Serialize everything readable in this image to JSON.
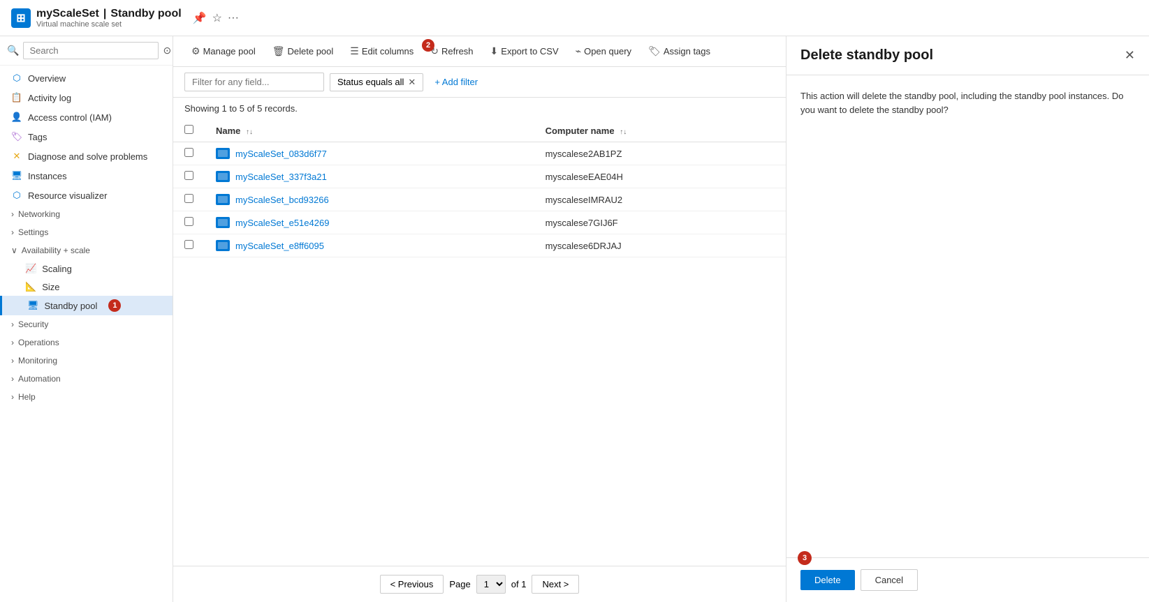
{
  "header": {
    "app_title": "myScaleSet",
    "separator": "|",
    "page_title": "Standby pool",
    "subtitle": "Virtual machine scale set",
    "pin_icon": "📌",
    "star_icon": "☆",
    "more_icon": "···"
  },
  "sidebar": {
    "search_placeholder": "Search",
    "nav_items": [
      {
        "id": "overview",
        "label": "Overview",
        "icon": "🏠",
        "indent": false,
        "active": false
      },
      {
        "id": "activity-log",
        "label": "Activity log",
        "icon": "📋",
        "indent": false,
        "active": false
      },
      {
        "id": "iam",
        "label": "Access control (IAM)",
        "icon": "👤",
        "indent": false,
        "active": false
      },
      {
        "id": "tags",
        "label": "Tags",
        "icon": "🏷",
        "indent": false,
        "active": false
      },
      {
        "id": "diagnose",
        "label": "Diagnose and solve problems",
        "icon": "🔧",
        "indent": false,
        "active": false
      },
      {
        "id": "instances",
        "label": "Instances",
        "icon": "💻",
        "indent": false,
        "active": false
      },
      {
        "id": "resource-viz",
        "label": "Resource visualizer",
        "icon": "🔗",
        "indent": false,
        "active": false
      },
      {
        "id": "networking",
        "label": "Networking",
        "icon": ">",
        "indent": false,
        "active": false,
        "group": true
      },
      {
        "id": "settings",
        "label": "Settings",
        "icon": ">",
        "indent": false,
        "active": false,
        "group": true
      },
      {
        "id": "avail-scale",
        "label": "Availability + scale",
        "icon": "v",
        "indent": false,
        "active": false,
        "group": true,
        "expanded": true
      },
      {
        "id": "scaling",
        "label": "Scaling",
        "icon": "📈",
        "indent": true,
        "active": false
      },
      {
        "id": "size",
        "label": "Size",
        "icon": "📐",
        "indent": true,
        "active": false
      },
      {
        "id": "standby-pool",
        "label": "Standby pool",
        "icon": "🖥",
        "indent": true,
        "active": true,
        "badge": 1
      },
      {
        "id": "security",
        "label": "Security",
        "icon": ">",
        "indent": false,
        "active": false,
        "group": true
      },
      {
        "id": "operations",
        "label": "Operations",
        "icon": ">",
        "indent": false,
        "active": false,
        "group": true
      },
      {
        "id": "monitoring",
        "label": "Monitoring",
        "icon": ">",
        "indent": false,
        "active": false,
        "group": true
      },
      {
        "id": "automation",
        "label": "Automation",
        "icon": ">",
        "indent": false,
        "active": false,
        "group": true
      },
      {
        "id": "help",
        "label": "Help",
        "icon": ">",
        "indent": false,
        "active": false,
        "group": true
      }
    ]
  },
  "toolbar": {
    "manage_pool_label": "Manage pool",
    "delete_pool_label": "Delete pool",
    "edit_columns_label": "Edit columns",
    "refresh_label": "Refresh",
    "export_csv_label": "Export to CSV",
    "open_query_label": "Open query",
    "assign_tags_label": "Assign tags",
    "toolbar_badge": "2"
  },
  "filter": {
    "placeholder": "Filter for any field...",
    "status_filter": "Status equals all",
    "add_filter_label": "+ Add filter"
  },
  "table": {
    "records_text": "Showing 1 to 5 of 5 records.",
    "col_name": "Name",
    "col_computer_name": "Computer name",
    "rows": [
      {
        "name": "myScaleSet_083d6f77",
        "computer_name": "myscalese2AB1PZ"
      },
      {
        "name": "myScaleSet_337f3a21",
        "computer_name": "myscaleseEAE04H"
      },
      {
        "name": "myScaleSet_bcd93266",
        "computer_name": "myscaleseIMRAU2"
      },
      {
        "name": "myScaleSet_e51e4269",
        "computer_name": "myscalese7GIJ6F"
      },
      {
        "name": "myScaleSet_e8ff6095",
        "computer_name": "myscalese6DRJAJ"
      }
    ]
  },
  "pagination": {
    "previous_label": "< Previous",
    "next_label": "Next >",
    "page_label": "Page",
    "of_label": "of 1",
    "page_options": [
      "1"
    ]
  },
  "right_panel": {
    "title": "Delete standby pool",
    "close_label": "✕",
    "description": "This action will delete the standby pool, including the standby pool instances. Do you want to delete the standby pool?",
    "delete_label": "Delete",
    "cancel_label": "Cancel",
    "badge": "3"
  }
}
